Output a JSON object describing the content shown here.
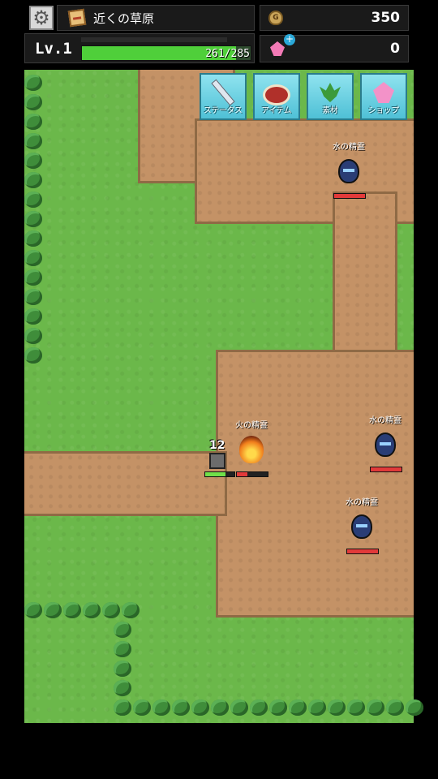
{
  "header": {
    "settings_icon": "gear-icon",
    "location_icon": "map-icon",
    "location_name": "近くの草原",
    "gold_icon": "gold-bag-icon",
    "gold": "350",
    "gem_icon": "pink-crystal-icon",
    "gems": "0"
  },
  "player": {
    "level_label": "Lv.1",
    "hp_text": "261/285",
    "hp_current": 261,
    "hp_max": 285
  },
  "menu": [
    {
      "label": "ステータス",
      "icon": "sword-icon"
    },
    {
      "label": "アイテム",
      "icon": "meat-icon"
    },
    {
      "label": "素材",
      "icon": "herb-icon"
    },
    {
      "label": "ショップ",
      "icon": "crystal-icon"
    }
  ],
  "battle": {
    "damage_popup": "12",
    "hero_hp_fraction": 0.7,
    "enemies": [
      {
        "name": "水の精霊",
        "type": "water",
        "hp_fraction": 1.0
      },
      {
        "name": "火の精霊",
        "type": "fire",
        "hp_fraction": 0.35
      },
      {
        "name": "水の精霊",
        "type": "water",
        "hp_fraction": 1.0
      },
      {
        "name": "水の精霊",
        "type": "water",
        "hp_fraction": 1.0
      }
    ]
  },
  "colors": {
    "grass": "#6bb84a",
    "dirt": "#c49266",
    "hp_green": "#4fcf3a",
    "enemy_hp": "#e23a3a",
    "button": "#5fcde0"
  }
}
